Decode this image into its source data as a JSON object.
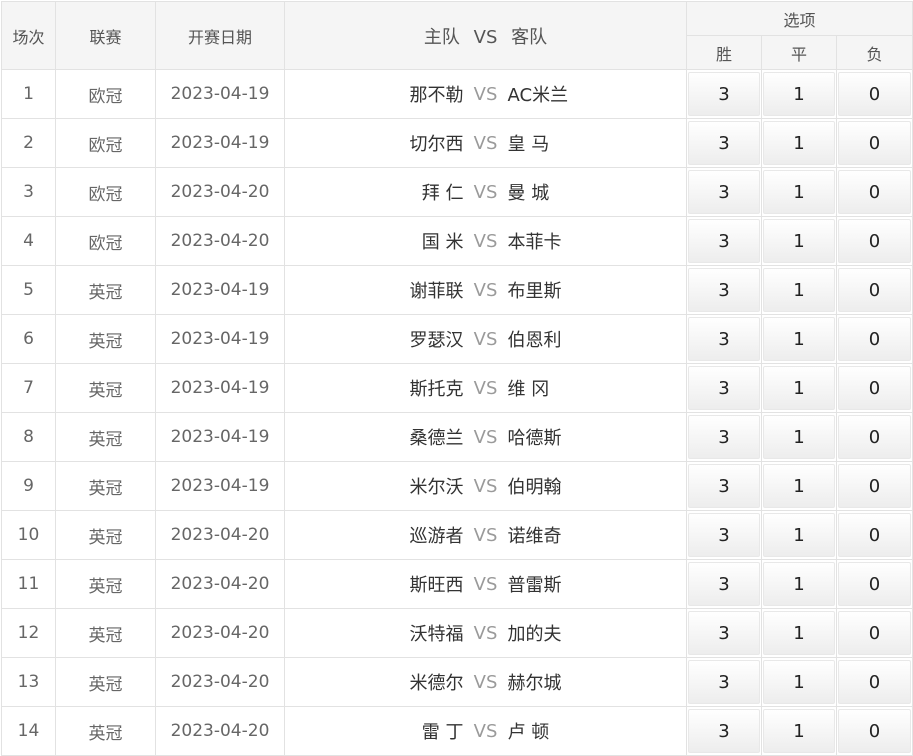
{
  "header": {
    "col_index": "场次",
    "col_league": "联赛",
    "col_date": "开赛日期",
    "col_match_home": "主队",
    "col_match_vs": "VS",
    "col_match_away": "客队",
    "col_options": "选项",
    "opt_win": "胜",
    "opt_draw": "平",
    "opt_lose": "负"
  },
  "rows": [
    {
      "no": "1",
      "league": "欧冠",
      "date": "2023-04-19",
      "home": "那不勒",
      "vs": "VS",
      "away": "AC米兰",
      "win": "3",
      "draw": "1",
      "lose": "0"
    },
    {
      "no": "2",
      "league": "欧冠",
      "date": "2023-04-19",
      "home": "切尔西",
      "vs": "VS",
      "away": "皇 马",
      "win": "3",
      "draw": "1",
      "lose": "0"
    },
    {
      "no": "3",
      "league": "欧冠",
      "date": "2023-04-20",
      "home": "拜 仁",
      "vs": "VS",
      "away": "曼 城",
      "win": "3",
      "draw": "1",
      "lose": "0"
    },
    {
      "no": "4",
      "league": "欧冠",
      "date": "2023-04-20",
      "home": "国 米",
      "vs": "VS",
      "away": "本菲卡",
      "win": "3",
      "draw": "1",
      "lose": "0"
    },
    {
      "no": "5",
      "league": "英冠",
      "date": "2023-04-19",
      "home": "谢菲联",
      "vs": "VS",
      "away": "布里斯",
      "win": "3",
      "draw": "1",
      "lose": "0"
    },
    {
      "no": "6",
      "league": "英冠",
      "date": "2023-04-19",
      "home": "罗瑟汉",
      "vs": "VS",
      "away": "伯恩利",
      "win": "3",
      "draw": "1",
      "lose": "0"
    },
    {
      "no": "7",
      "league": "英冠",
      "date": "2023-04-19",
      "home": "斯托克",
      "vs": "VS",
      "away": "维 冈",
      "win": "3",
      "draw": "1",
      "lose": "0"
    },
    {
      "no": "8",
      "league": "英冠",
      "date": "2023-04-19",
      "home": "桑德兰",
      "vs": "VS",
      "away": "哈德斯",
      "win": "3",
      "draw": "1",
      "lose": "0"
    },
    {
      "no": "9",
      "league": "英冠",
      "date": "2023-04-19",
      "home": "米尔沃",
      "vs": "VS",
      "away": "伯明翰",
      "win": "3",
      "draw": "1",
      "lose": "0"
    },
    {
      "no": "10",
      "league": "英冠",
      "date": "2023-04-20",
      "home": "巡游者",
      "vs": "VS",
      "away": "诺维奇",
      "win": "3",
      "draw": "1",
      "lose": "0"
    },
    {
      "no": "11",
      "league": "英冠",
      "date": "2023-04-20",
      "home": "斯旺西",
      "vs": "VS",
      "away": "普雷斯",
      "win": "3",
      "draw": "1",
      "lose": "0"
    },
    {
      "no": "12",
      "league": "英冠",
      "date": "2023-04-20",
      "home": "沃特福",
      "vs": "VS",
      "away": "加的夫",
      "win": "3",
      "draw": "1",
      "lose": "0"
    },
    {
      "no": "13",
      "league": "英冠",
      "date": "2023-04-20",
      "home": "米德尔",
      "vs": "VS",
      "away": "赫尔城",
      "win": "3",
      "draw": "1",
      "lose": "0"
    },
    {
      "no": "14",
      "league": "英冠",
      "date": "2023-04-20",
      "home": "雷 丁",
      "vs": "VS",
      "away": "卢 顿",
      "win": "3",
      "draw": "1",
      "lose": "0"
    }
  ]
}
